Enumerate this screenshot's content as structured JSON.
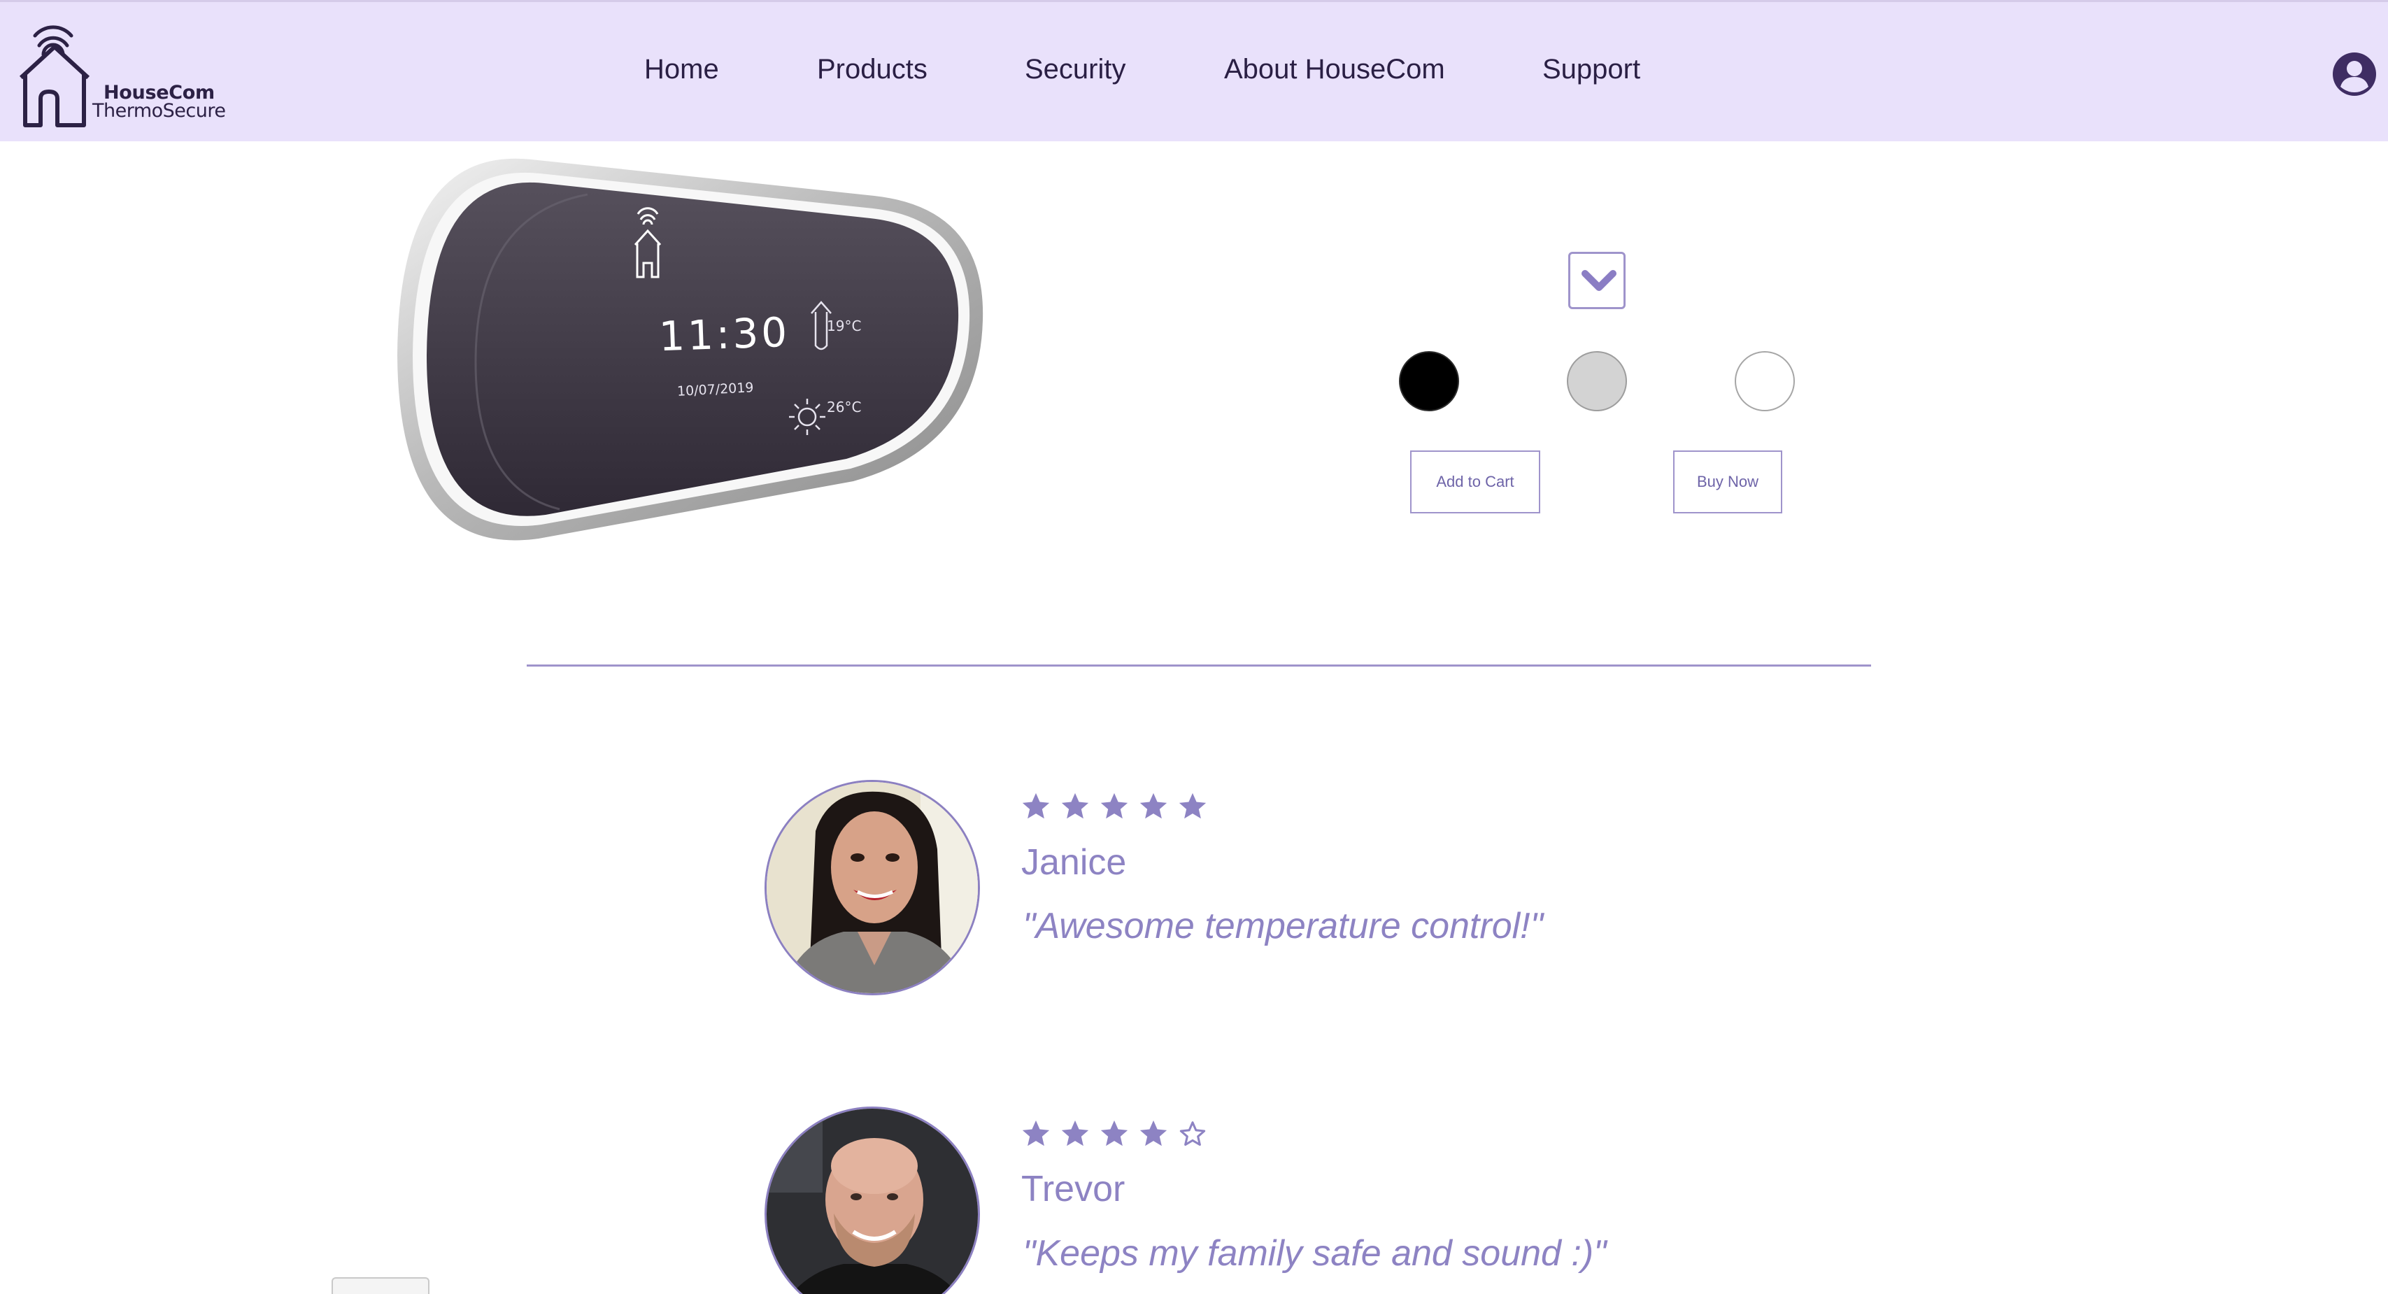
{
  "header": {
    "logo": {
      "brand": "HouseCom",
      "product": "ThermoSecure",
      "icon": "house-wifi-icon"
    },
    "nav": [
      {
        "label": "Home"
      },
      {
        "label": "Products"
      },
      {
        "label": "Security"
      },
      {
        "label": "About HouseCom"
      },
      {
        "label": "Support"
      }
    ],
    "account_icon": "user-circle-icon"
  },
  "product": {
    "display": {
      "time": "11:30",
      "date": "10/07/2019",
      "indoor_temp": "19°C",
      "outdoor_temp": "26°C"
    },
    "variant_dropdown_icon": "chevron-down-icon",
    "color_options": [
      {
        "color": "#000000"
      },
      {
        "color": "#d3d3d3"
      },
      {
        "color": "#ffffff"
      }
    ],
    "add_to_cart_label": "Add to Cart",
    "buy_now_label": "Buy Now"
  },
  "reviews": [
    {
      "rating": 5,
      "max_rating": 5,
      "name": "Janice",
      "quote": "\"Awesome temperature control!\""
    },
    {
      "rating": 4,
      "max_rating": 5,
      "name": "Trevor",
      "quote": "\"Keeps my family safe and sound :)\""
    }
  ],
  "colors": {
    "header_bg": "#e9e1fb",
    "accent": "#8d83c3",
    "nav_text": "#2a1f44"
  }
}
